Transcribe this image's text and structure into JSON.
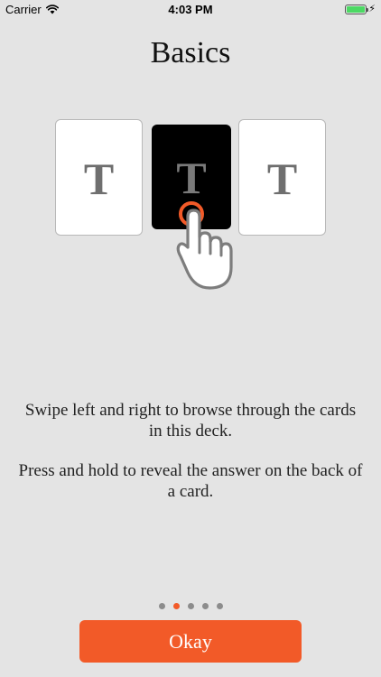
{
  "status_bar": {
    "carrier": "Carrier",
    "time": "4:03 PM",
    "battery_level": 1.0,
    "wifi_icon": "wifi-icon",
    "battery_icon": "battery-icon",
    "charging_icon": "bolt-icon"
  },
  "title": "Basics",
  "cards": [
    {
      "letter": "T",
      "style": "light"
    },
    {
      "letter": "T",
      "style": "dark"
    },
    {
      "letter": "T",
      "style": "light"
    }
  ],
  "gesture_icon": "hand-press-icon",
  "instructions": {
    "swipe": "Swipe left and right to browse through the cards in this deck.",
    "hold": "Press and hold to reveal the answer on the back of a card."
  },
  "pagination": {
    "count": 5,
    "active_index": 1
  },
  "okay_button": {
    "label": "Okay"
  },
  "colors": {
    "accent": "#f25a28",
    "background": "#e4e4e4",
    "dot_inactive": "#8c8c8c",
    "battery": "#4cd964"
  }
}
